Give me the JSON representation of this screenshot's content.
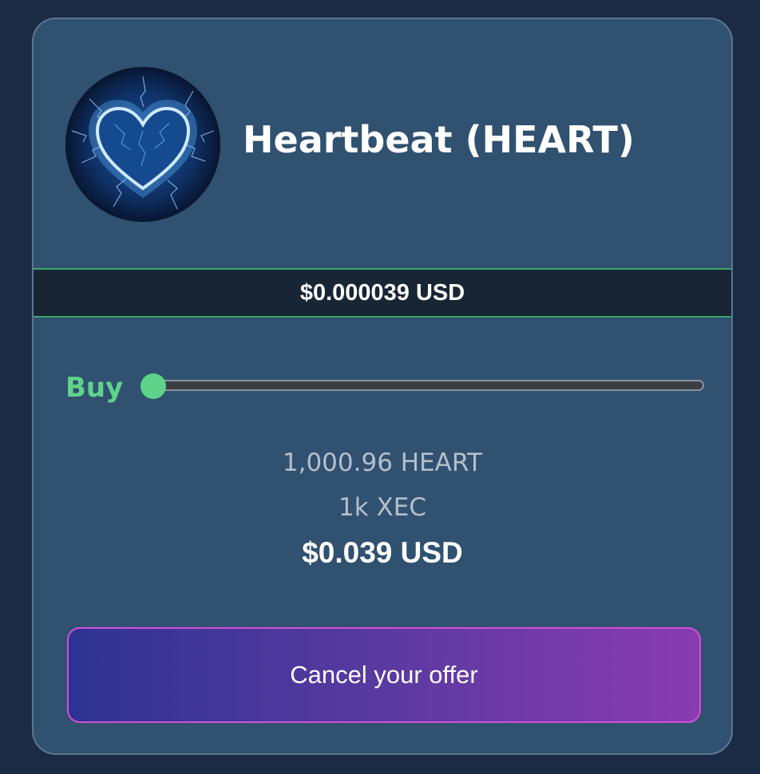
{
  "token": {
    "name": "Heartbeat (HEART)",
    "icon": "glowing-blue-heart-icon",
    "price": "$0.000039 USD"
  },
  "order": {
    "side": "Buy",
    "slider_fraction": 0,
    "token_amount": "1,000.96 HEART",
    "xec_amount": "1k XEC",
    "usd_amount": "$0.039 USD"
  },
  "actions": {
    "cancel_label": "Cancel your offer"
  },
  "colors": {
    "background": "#1c2b45",
    "card": "#30516f",
    "accent_green": "#5fd38a",
    "price_border": "#3fa56a",
    "button_gradient_start": "#2e3393",
    "button_gradient_end": "#8a3bb0",
    "button_border": "#d24fd8"
  }
}
